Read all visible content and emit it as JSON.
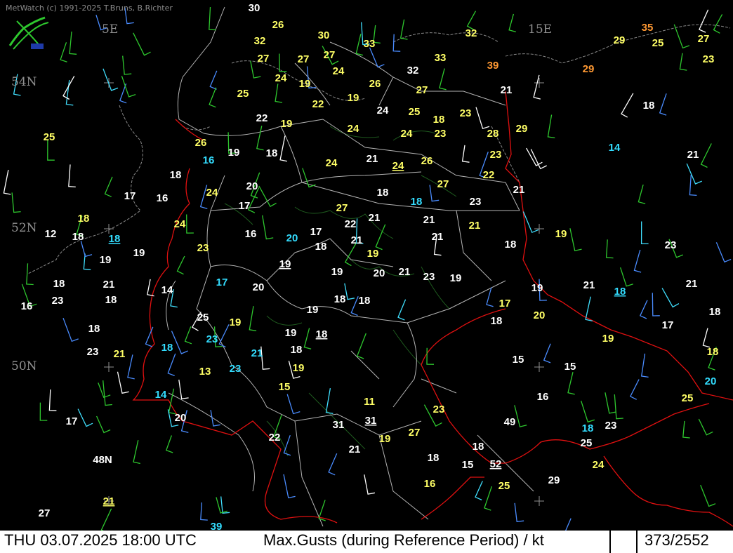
{
  "credit": "MetWatch  (c) 1991-2025 T.Bruns, B.Richter",
  "grid_labels": {
    "lon_5": "5E",
    "lon_15": "15E",
    "lat_54": "54N",
    "lat_52": "52N",
    "lat_50": "50N",
    "lat_48": "48N"
  },
  "status": {
    "datetime": "THU 03.07.2025 18:00 UTC",
    "product": "Max.Gusts (during Reference Period) / kt",
    "counter": "373/2552"
  },
  "colors": {
    "white": "#ffffff",
    "yellow": "#ffff66",
    "cyan": "#33ddff",
    "orange": "#ff9933",
    "red": "#ff1a55",
    "border": "#e01010",
    "region_line": "#b4b4b4",
    "coast": "#888888",
    "forest": "#1e5a1e"
  },
  "gust_values": [
    "30",
    "26",
    "30",
    "32",
    "32",
    "35",
    "29",
    "25",
    "27",
    "23",
    "27",
    "27",
    "27",
    "33",
    "33",
    "39",
    "29",
    "24",
    "19",
    "24",
    "32",
    "26",
    "25",
    "22",
    "27",
    "19",
    "21",
    "18",
    "24",
    "25",
    "23",
    "18",
    "29",
    "19",
    "22",
    "23",
    "28",
    "25",
    "26",
    "24",
    "24",
    "14",
    "19",
    "18",
    "21",
    "21",
    "23",
    "24",
    "24",
    "26",
    "22",
    "18",
    "16",
    "27",
    "21",
    "18",
    "20",
    "17",
    "24",
    "18",
    "16",
    "17",
    "23",
    "27",
    "18",
    "21",
    "21",
    "22",
    "24",
    "21",
    "19",
    "18",
    "12",
    "18",
    "21",
    "19",
    "16",
    "20",
    "17",
    "18",
    "21",
    "23",
    "23",
    "19",
    "18",
    "19",
    "19",
    "21",
    "20",
    "19",
    "23",
    "19",
    "21",
    "18",
    "14",
    "17",
    "20",
    "21",
    "18",
    "19",
    "21",
    "18",
    "16",
    "23",
    "18",
    "18",
    "17",
    "20",
    "19",
    "18",
    "18",
    "18",
    "25",
    "19",
    "17",
    "19",
    "18",
    "19",
    "18",
    "23",
    "21",
    "18",
    "23",
    "15",
    "15",
    "21",
    "18",
    "13",
    "19",
    "23",
    "20",
    "14",
    "15",
    "16",
    "25",
    "11",
    "17",
    "23",
    "20",
    "31",
    "31",
    "18",
    "23",
    "49",
    "27",
    "19",
    "22",
    "25",
    "21",
    "48N",
    "18",
    "24",
    "18",
    "15",
    "52",
    "25",
    "29",
    "16",
    "21",
    "27",
    "39"
  ]
}
